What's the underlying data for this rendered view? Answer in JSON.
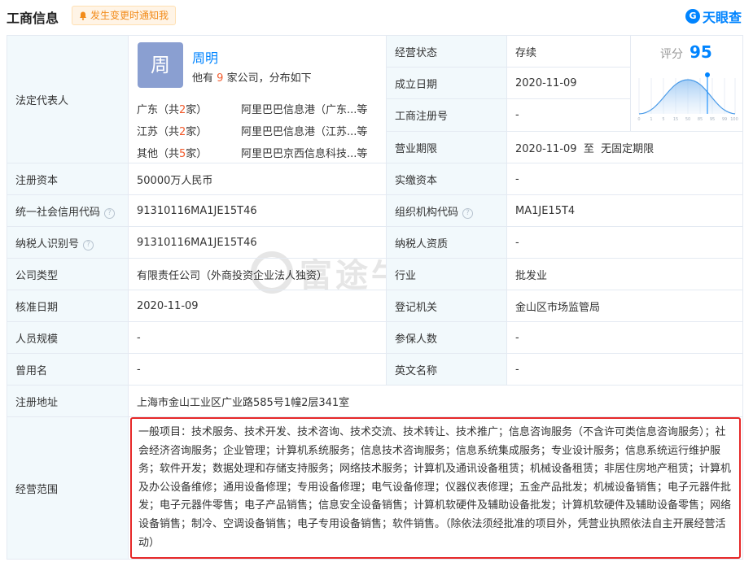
{
  "header": {
    "title": "工商信息",
    "notify_label": "发生变更时通知我",
    "logo_text": "天眼查",
    "logo_mark": "G"
  },
  "legal_rep": {
    "label": "法定代表人",
    "avatar_char": "周",
    "name": "周明",
    "sub_prefix": "他有",
    "company_count": "9",
    "sub_suffix": "家公司，分布如下",
    "regions": [
      {
        "prefix": "广东（共",
        "count": "2",
        "suffix": "家）",
        "company": "阿里巴巴信息港（广东...等"
      },
      {
        "prefix": "江苏（共",
        "count": "2",
        "suffix": "家）",
        "company": "阿里巴巴信息港（江苏...等"
      },
      {
        "prefix": "其他（共",
        "count": "5",
        "suffix": "家）",
        "company": "阿里巴巴京西信息科技...等"
      }
    ]
  },
  "right_top": [
    {
      "label": "经营状态",
      "value": "存续"
    },
    {
      "label": "成立日期",
      "value": "2020-11-09"
    },
    {
      "label": "工商注册号",
      "value": "-"
    },
    {
      "label": "营业期限",
      "value": "2020-11-09  至  无固定期限"
    }
  ],
  "score": {
    "label": "评分",
    "value": "95",
    "ticks": [
      "0",
      "1",
      "5",
      "15",
      "50",
      "85",
      "95",
      "99",
      "100"
    ]
  },
  "rows": [
    {
      "l1": "注册资本",
      "v1": "50000万人民币",
      "l2": "实缴资本",
      "v2": "-"
    },
    {
      "l1": "统一社会信用代码",
      "v1": "91310116MA1JE15T46",
      "l2": "组织机构代码",
      "v2": "MA1JE15T4"
    },
    {
      "l1": "纳税人识别号",
      "v1": "91310116MA1JE15T46",
      "l2": "纳税人资质",
      "v2": "-"
    },
    {
      "l1": "公司类型",
      "v1": "有限责任公司（外商投资企业法人独资）",
      "l2": "行业",
      "v2": "批发业"
    },
    {
      "l1": "核准日期",
      "v1": "2020-11-09",
      "l2": "登记机关",
      "v2": "金山区市场监管局"
    },
    {
      "l1": "人员规模",
      "v1": "-",
      "l2": "参保人数",
      "v2": "-"
    },
    {
      "l1": "曾用名",
      "v1": "-",
      "l2": "英文名称",
      "v2": "-"
    }
  ],
  "address": {
    "label": "注册地址",
    "value": "上海市金山工业区广业路585号1幢2层341室"
  },
  "scope": {
    "label": "经营范围",
    "text": "一般项目：技术服务、技术开发、技术咨询、技术交流、技术转让、技术推广；信息咨询服务（不含许可类信息咨询服务）；社会经济咨询服务；企业管理；计算机系统服务；信息技术咨询服务；信息系统集成服务；专业设计服务；信息系统运行维护服务；软件开发；数据处理和存储支持服务；网络技术服务；计算机及通讯设备租赁；机械设备租赁；非居住房地产租赁；计算机及办公设备维修；通用设备修理；专用设备修理；电气设备修理；仪器仪表修理；五金产品批发；机械设备销售；电子元器件批发；电子元器件零售；电子产品销售；信息安全设备销售；计算机软硬件及辅助设备批发；计算机软硬件及辅助设备零售；网络设备销售；制冷、空调设备销售；电子专用设备销售；软件销售。（除依法须经批准的项目外，凭营业执照依法自主开展经营活动）"
  },
  "watermark": "富途牛牛",
  "colors": {
    "accent": "#0084ff",
    "highlight": "#f25c2e",
    "label_bg": "#f2f9fc",
    "scope_border": "#e62828"
  }
}
